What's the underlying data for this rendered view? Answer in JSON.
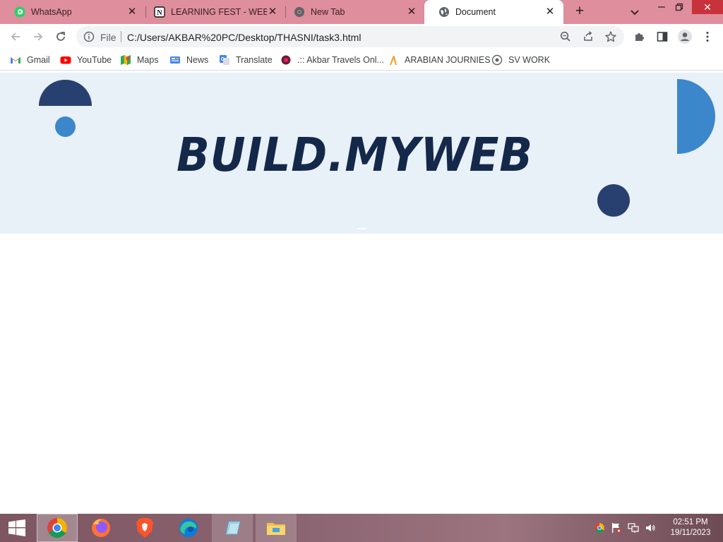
{
  "browser": {
    "tabs": [
      {
        "title": "WhatsApp",
        "icon": "whatsapp-icon",
        "active": false
      },
      {
        "title": "LEARNING FEST - WEB DI",
        "icon": "notion-icon",
        "active": false
      },
      {
        "title": "New Tab",
        "icon": "chrome-icon",
        "active": false
      },
      {
        "title": "Document",
        "icon": "globe-icon",
        "active": true
      }
    ],
    "address": {
      "scheme": "File",
      "url": "C:/Users/AKBAR%20PC/Desktop/THASNI/task3.html"
    },
    "bookmarks": [
      {
        "label": "Gmail",
        "icon": "gmail-icon"
      },
      {
        "label": "YouTube",
        "icon": "youtube-icon"
      },
      {
        "label": "Maps",
        "icon": "maps-icon"
      },
      {
        "label": "News",
        "icon": "news-icon"
      },
      {
        "label": "Translate",
        "icon": "translate-icon"
      },
      {
        "label": ".:: Akbar Travels Onl...",
        "icon": "akbar-travels-icon"
      },
      {
        "label": "ARABIAN JOURNIES",
        "icon": "arabian-journies-icon"
      },
      {
        "label": "SV WORK",
        "icon": "sv-work-icon"
      }
    ]
  },
  "page": {
    "brand": "BUILD.MYWEB",
    "colors": {
      "navy": "#28406f",
      "blue": "#3c86cc",
      "hero_bg": "#e8f0f8",
      "brand_text": "#14284a"
    }
  },
  "taskbar": {
    "apps": [
      "windows-start-icon",
      "chrome-icon",
      "firefox-icon",
      "brave-icon",
      "edge-icon",
      "notepad-icon",
      "file-explorer-icon"
    ],
    "clock": {
      "time": "02:51 PM",
      "date": "19/11/2023"
    }
  }
}
